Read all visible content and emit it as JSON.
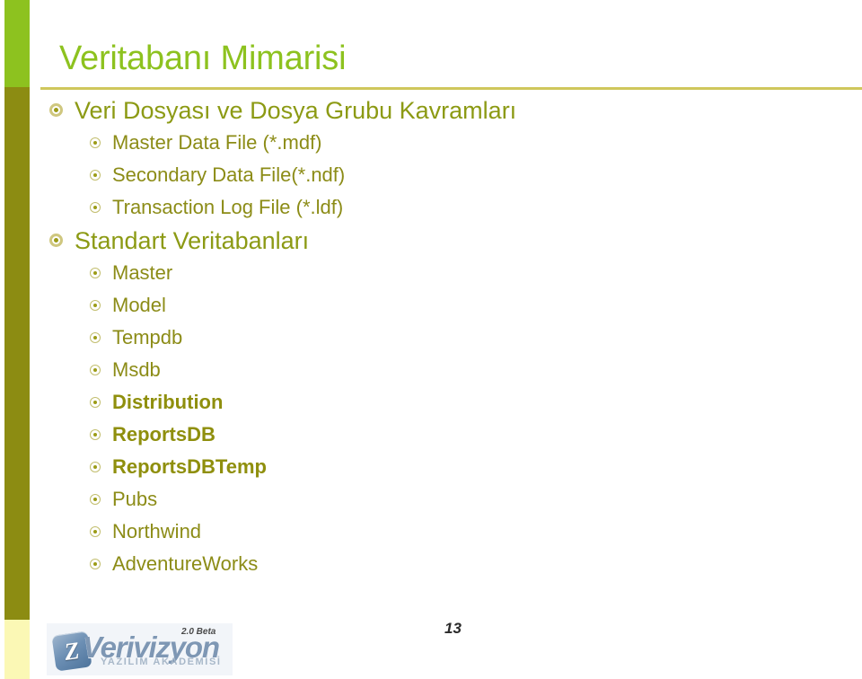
{
  "slide": {
    "title": "Veritabanı Mimarisi",
    "page_number": "13",
    "accent_bar": {
      "top_color": "#8DC21F",
      "middle_color": "#8C8C12",
      "bottom_color": "#FBF8B5"
    },
    "colors": {
      "title": "#8DC21F",
      "rule": "#CFC75C",
      "body_text": "#8C8C17",
      "bullet_ring": "#CFC77F",
      "bullet_dot": "#9C9C17"
    },
    "content": [
      {
        "level": 1,
        "text": "Veri Dosyası ve Dosya Grubu Kavramları",
        "bold": false
      },
      {
        "level": 2,
        "text": "Master Data File (*.mdf)",
        "bold": false
      },
      {
        "level": 2,
        "text": "Secondary Data File(*.ndf)",
        "bold": false
      },
      {
        "level": 2,
        "text": "Transaction Log File (*.ldf)",
        "bold": false
      },
      {
        "level": 1,
        "text": "Standart Veritabanları",
        "bold": false
      },
      {
        "level": 2,
        "text": "Master",
        "bold": false
      },
      {
        "level": 2,
        "text": "Model",
        "bold": false
      },
      {
        "level": 2,
        "text": "Tempdb",
        "bold": false
      },
      {
        "level": 2,
        "text": "Msdb",
        "bold": false
      },
      {
        "level": 2,
        "text": "Distribution",
        "bold": true
      },
      {
        "level": 2,
        "text": "ReportsDB",
        "bold": true
      },
      {
        "level": 2,
        "text": "ReportsDBTemp",
        "bold": true
      },
      {
        "level": 2,
        "text": "Pubs",
        "bold": false
      },
      {
        "level": 2,
        "text": "Northwind",
        "bold": false
      },
      {
        "level": 2,
        "text": "AdventureWorks",
        "bold": false
      }
    ],
    "footer_logo": {
      "mark_letter": "Z",
      "wordmark": "Verivizyon",
      "subtitle": "YAZILIM AKADEMİSİ",
      "version": "2.0 Beta"
    }
  }
}
